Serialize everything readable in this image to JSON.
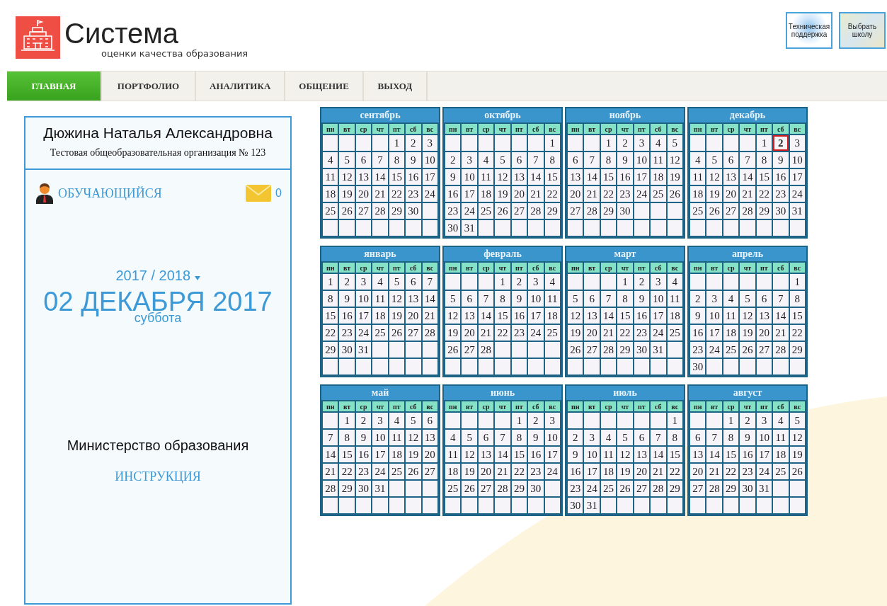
{
  "logo": {
    "title": "Система",
    "subtitle": "оценки качества образования"
  },
  "top_buttons": [
    {
      "label": "Техническая поддержка",
      "kind": "support"
    },
    {
      "label": "Выбрать школу",
      "kind": "map"
    }
  ],
  "nav": [
    {
      "label": "ГЛАВНАЯ",
      "selected": true
    },
    {
      "label": "ПОРТФОЛИО",
      "selected": false
    },
    {
      "label": "АНАЛИТИКА",
      "selected": false
    },
    {
      "label": "ОБЩЕНИЕ",
      "selected": false
    },
    {
      "label": "ВЫХОД",
      "selected": false
    }
  ],
  "profile": {
    "name": "Дюжина Наталья Александровна",
    "organization": "Тестовая общеобразовательная организация  № 123",
    "role": "ОБУЧАЮЩИЙСЯ",
    "messages": "0",
    "school_year": "2017 / 2018",
    "date": "02 ДЕКАБРЯ 2017",
    "weekday": "суббота",
    "ministry": "Министерство образования",
    "instructions_link": "ИНСТРУКЦИЯ"
  },
  "calendar": [
    {
      "month": "сентябрь",
      "weekdays": [
        "пн",
        "вт",
        "ср",
        "чт",
        "пт",
        "сб",
        "вс"
      ],
      "weeks": [
        [
          "1",
          "2",
          "3"
        ],
        [
          "4",
          "5",
          "6",
          "7",
          "8",
          "9",
          "10"
        ],
        [
          "11",
          "12",
          "13",
          "14",
          "15",
          "16",
          "17"
        ],
        [
          "18",
          "19",
          "20",
          "21",
          "22",
          "23",
          "24"
        ],
        [
          "25",
          "26",
          "27",
          "28",
          "29",
          "30"
        ]
      ]
    },
    {
      "month": "октябрь",
      "weekdays": [
        "пн",
        "вт",
        "ср",
        "чт",
        "пт",
        "сб",
        "вс"
      ],
      "weeks": [
        [
          "1"
        ],
        [
          "2",
          "3",
          "4",
          "5",
          "6",
          "7",
          "8"
        ],
        [
          "9",
          "10",
          "11",
          "12",
          "13",
          "14",
          "15"
        ],
        [
          "16",
          "17",
          "18",
          "19",
          "20",
          "21",
          "22"
        ],
        [
          "23",
          "24",
          "25",
          "26",
          "27",
          "28",
          "29"
        ],
        [
          "30",
          "31"
        ]
      ]
    },
    {
      "month": "ноябрь",
      "weekdays": [
        "пн",
        "вт",
        "ср",
        "чт",
        "пт",
        "сб",
        "вс"
      ],
      "weeks": [
        [
          "1",
          "2",
          "3",
          "4",
          "5"
        ],
        [
          "6",
          "7",
          "8",
          "9",
          "10",
          "11",
          "12"
        ],
        [
          "13",
          "14",
          "15",
          "16",
          "17",
          "18",
          "19"
        ],
        [
          "20",
          "21",
          "22",
          "23",
          "24",
          "25",
          "26"
        ],
        [
          "27",
          "28",
          "29",
          "30"
        ]
      ]
    },
    {
      "month": "декабрь",
      "weekdays": [
        "пн",
        "вт",
        "ср",
        "чт",
        "пт",
        "сб",
        "вс"
      ],
      "weeks": [
        [
          "1",
          {
            "day": "2",
            "selected": true
          },
          "3"
        ],
        [
          "4",
          "5",
          "6",
          "7",
          "8",
          "9",
          "10"
        ],
        [
          "11",
          "12",
          "13",
          "14",
          "15",
          "16",
          "17"
        ],
        [
          "18",
          "19",
          "20",
          "21",
          "22",
          "23",
          "24"
        ],
        [
          "25",
          "26",
          "27",
          "28",
          "29",
          "30",
          "31"
        ]
      ]
    },
    {
      "month": "январь",
      "weekdays": [
        "пн",
        "вт",
        "ср",
        "чт",
        "пт",
        "сб",
        "вс"
      ],
      "weeks": [
        [
          "1",
          "2",
          "3",
          "4",
          "5",
          "6",
          "7"
        ],
        [
          "8",
          "9",
          "10",
          "11",
          "12",
          "13",
          "14"
        ],
        [
          "15",
          "16",
          "17",
          "18",
          "19",
          "20",
          "21"
        ],
        [
          "22",
          "23",
          "24",
          "25",
          "26",
          "27",
          "28"
        ],
        [
          "29",
          "30",
          "31"
        ]
      ]
    },
    {
      "month": "февраль",
      "weekdays": [
        "пн",
        "вт",
        "ср",
        "чт",
        "пт",
        "сб",
        "вс"
      ],
      "weeks": [
        [
          "1",
          "2",
          "3",
          "4"
        ],
        [
          "5",
          "6",
          "7",
          "8",
          "9",
          "10",
          "11"
        ],
        [
          "12",
          "13",
          "14",
          "15",
          "16",
          "17",
          "18"
        ],
        [
          "19",
          "20",
          "21",
          "22",
          "23",
          "24",
          "25"
        ],
        [
          "26",
          "27",
          "28"
        ]
      ]
    },
    {
      "month": "март",
      "weekdays": [
        "пн",
        "вт",
        "ср",
        "чт",
        "пт",
        "сб",
        "вс"
      ],
      "weeks": [
        [
          "1",
          "2",
          "3",
          "4"
        ],
        [
          "5",
          "6",
          "7",
          "8",
          "9",
          "10",
          "11"
        ],
        [
          "12",
          "13",
          "14",
          "15",
          "16",
          "17",
          "18"
        ],
        [
          "19",
          "20",
          "21",
          "22",
          "23",
          "24",
          "25"
        ],
        [
          "26",
          "27",
          "28",
          "29",
          "30",
          "31"
        ]
      ]
    },
    {
      "month": "апрель",
      "weekdays": [
        "пн",
        "вт",
        "ср",
        "чт",
        "пт",
        "сб",
        "вс"
      ],
      "weeks": [
        [
          "1"
        ],
        [
          "2",
          "3",
          "4",
          "5",
          "6",
          "7",
          "8"
        ],
        [
          "9",
          "10",
          "11",
          "12",
          "13",
          "14",
          "15"
        ],
        [
          "16",
          "17",
          "18",
          "19",
          "20",
          "21",
          "22"
        ],
        [
          "23",
          "24",
          "25",
          "26",
          "27",
          "28",
          "29"
        ],
        [
          "30"
        ]
      ]
    },
    {
      "month": "май",
      "weekdays": [
        "пн",
        "вт",
        "ср",
        "чт",
        "пт",
        "сб",
        "вс"
      ],
      "weeks": [
        [
          "1",
          "2",
          "3",
          "4",
          "5",
          "6"
        ],
        [
          "7",
          "8",
          "9",
          "10",
          "11",
          "12",
          "13"
        ],
        [
          "14",
          "15",
          "16",
          "17",
          "18",
          "19",
          "20"
        ],
        [
          "21",
          "22",
          "23",
          "24",
          "25",
          "26",
          "27"
        ],
        [
          "28",
          "29",
          "30",
          "31"
        ]
      ]
    },
    {
      "month": "июнь",
      "weekdays": [
        "пн",
        "вт",
        "ср",
        "чт",
        "пт",
        "сб",
        "вс"
      ],
      "weeks": [
        [
          "1",
          "2",
          "3"
        ],
        [
          "4",
          "5",
          "6",
          "7",
          "8",
          "9",
          "10"
        ],
        [
          "11",
          "12",
          "13",
          "14",
          "15",
          "16",
          "17"
        ],
        [
          "18",
          "19",
          "20",
          "21",
          "22",
          "23",
          "24"
        ],
        [
          "25",
          "26",
          "27",
          "28",
          "29",
          "30"
        ]
      ]
    },
    {
      "month": "июль",
      "weekdays": [
        "пн",
        "вт",
        "ср",
        "чт",
        "пт",
        "сб",
        "вс"
      ],
      "weeks": [
        [
          "1"
        ],
        [
          "2",
          "3",
          "4",
          "5",
          "6",
          "7",
          "8"
        ],
        [
          "9",
          "10",
          "11",
          "12",
          "13",
          "14",
          "15"
        ],
        [
          "16",
          "17",
          "18",
          "19",
          "20",
          "21",
          "22"
        ],
        [
          "23",
          "24",
          "25",
          "26",
          "27",
          "28",
          "29"
        ],
        [
          "30",
          "31"
        ]
      ]
    },
    {
      "month": "август",
      "weekdays": [
        "пн",
        "вт",
        "ср",
        "чт",
        "пт",
        "сб",
        "вс"
      ],
      "weeks": [
        [
          "1",
          "2",
          "3",
          "4",
          "5"
        ],
        [
          "6",
          "7",
          "8",
          "9",
          "10",
          "11",
          "12"
        ],
        [
          "13",
          "14",
          "15",
          "16",
          "17",
          "18",
          "19"
        ],
        [
          "20",
          "21",
          "22",
          "23",
          "24",
          "25",
          "26"
        ],
        [
          "27",
          "28",
          "29",
          "30",
          "31"
        ]
      ]
    }
  ]
}
